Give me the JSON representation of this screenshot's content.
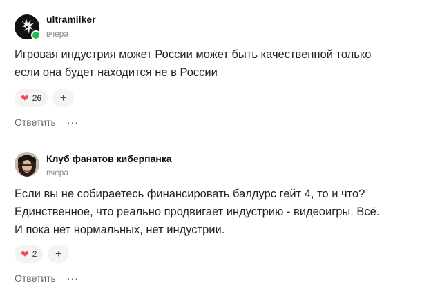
{
  "comments": [
    {
      "author": "ultramilker",
      "time": "вчера",
      "text_lines": [
        "Игровая индустрия может России может быть качественной только",
        "если она будет находится не в России"
      ],
      "reaction_count": "26",
      "add_reaction": "+",
      "reply": "Ответить",
      "more": "···"
    },
    {
      "author": "Клуб фанатов киберпанка",
      "time": "вчера",
      "text_lines": [
        "Если вы не собираетесь финансировать балдурс гейт 4, то и что?",
        "Единственное, что реально продвигает индустрию - видеоигры. Всё.",
        "И пока нет нормальных, нет индустрии."
      ],
      "reaction_count": "2",
      "add_reaction": "+",
      "reply": "Ответить",
      "more": "···"
    }
  ],
  "colors": {
    "online": "#1fbb52",
    "heart": "#f0465e",
    "chip_bg": "#f3f3f3"
  },
  "icons": {
    "reaction": "heart-icon",
    "add": "plus-icon",
    "more": "more-dots-icon"
  }
}
